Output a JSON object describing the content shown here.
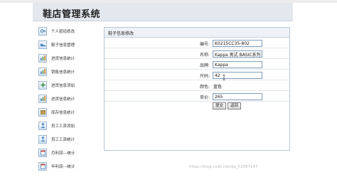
{
  "app": {
    "title": "鞋店管理系统"
  },
  "sidebar": {
    "items": [
      {
        "label": "个人密码修改",
        "icon": "key-icon"
      },
      {
        "label": "鞋子信息管理",
        "icon": "shoe-icon"
      },
      {
        "label": "进货信息统计",
        "icon": "chart-icon"
      },
      {
        "label": "销售信息统计",
        "icon": "chart-icon"
      },
      {
        "label": "进货信息添加",
        "icon": "add-icon"
      },
      {
        "label": "进货信息统计",
        "icon": "chart-icon"
      },
      {
        "label": "库存信息统计",
        "icon": "box-icon"
      },
      {
        "label": "员工工资添加",
        "icon": "user-icon"
      },
      {
        "label": "员工工资统计",
        "icon": "user-icon"
      },
      {
        "label": "月利润---统计",
        "icon": "calendar-icon"
      },
      {
        "label": "年利润---统计",
        "icon": "calendar-icon"
      }
    ]
  },
  "form": {
    "title": "鞋子信息修改",
    "fields": [
      {
        "label": "编号:",
        "value": "K0215CC35-802"
      },
      {
        "label": "名称:",
        "value": "Kappa 男式 BASIC系列"
      },
      {
        "label": "品牌:",
        "value": "Kappa"
      },
      {
        "label": "尺码:",
        "value": "42"
      },
      {
        "label": "颜色:",
        "value": "蓝色"
      },
      {
        "label": "单价:",
        "value": "265"
      }
    ],
    "submit_label": "提交",
    "back_label": "返回"
  },
  "watermark": "https://blog.csdn.net/qq_52067147"
}
